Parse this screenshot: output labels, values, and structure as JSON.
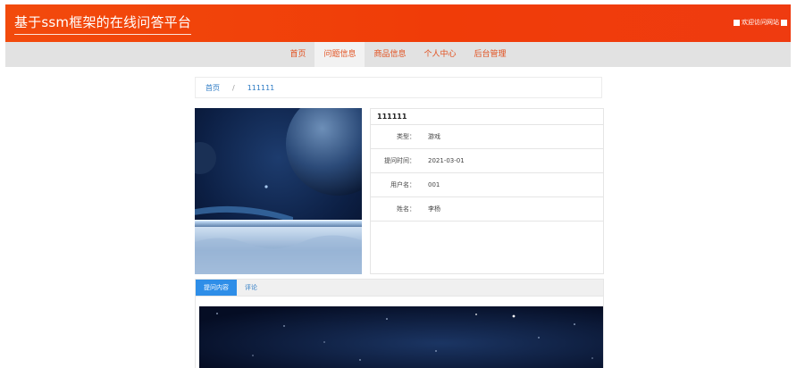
{
  "header": {
    "site_title": "基于ssm框架的在线问答平台",
    "welcome_text": "欢迎访问网站"
  },
  "nav": {
    "items": [
      "首页",
      "问题信息",
      "商品信息",
      "个人中心",
      "后台管理"
    ],
    "active_index": 1
  },
  "breadcrumb": {
    "home": "首页",
    "separator": "/",
    "current": "111111"
  },
  "question": {
    "title": "111111",
    "fields": [
      {
        "label": "类型：",
        "value": "游戏"
      },
      {
        "label": "提问时间：",
        "value": "2021-03-01"
      },
      {
        "label": "用户名：",
        "value": "001"
      },
      {
        "label": "姓名：",
        "value": "李杨"
      }
    ]
  },
  "tabs": {
    "items": [
      "提问内容",
      "评论"
    ],
    "active_index": 0
  },
  "colors": {
    "header_accent": "#f24a0c",
    "nav_text": "#e2501e",
    "link": "#2d7bc5",
    "tab_active": "#2e8ee8"
  }
}
